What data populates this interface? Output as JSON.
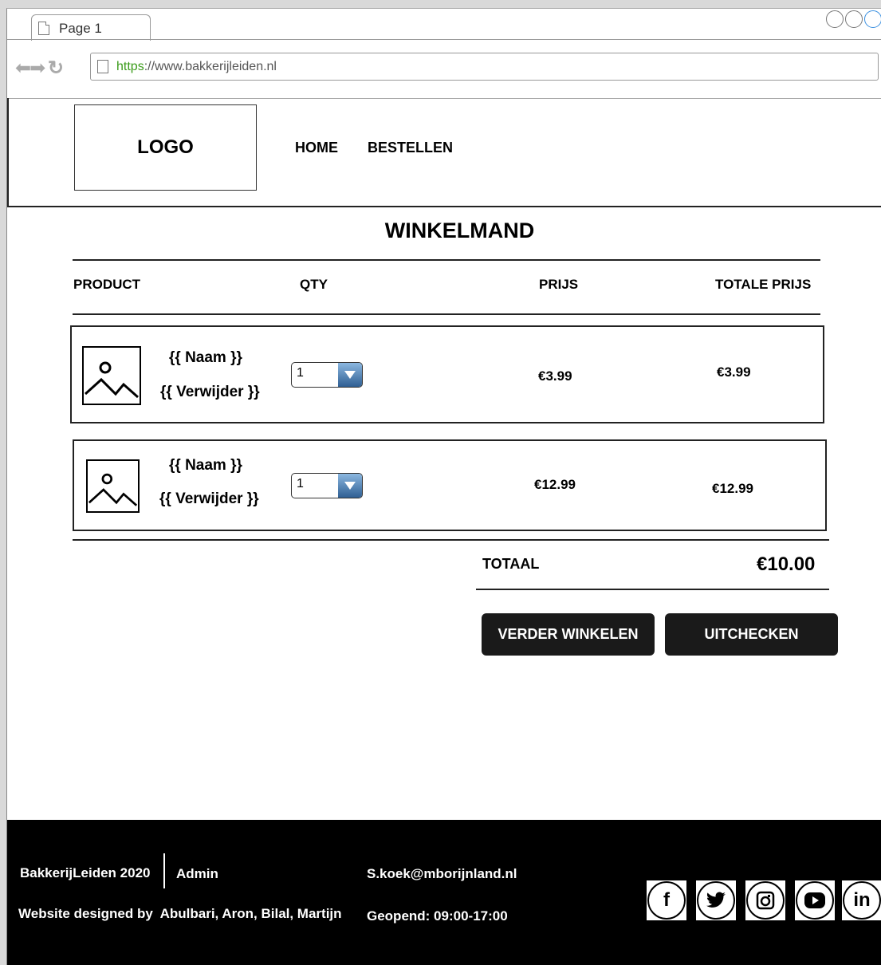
{
  "browser": {
    "tab_label": "Page 1",
    "url_scheme": "https",
    "url_rest": "://www.bakkerijleiden.nl"
  },
  "header": {
    "logo": "LOGO",
    "nav": [
      "HOME",
      "BESTELLEN"
    ]
  },
  "cart": {
    "title": "WINKELMAND",
    "columns": [
      "PRODUCT",
      "QTY",
      "PRIJS",
      "TOTALE PRIJS"
    ],
    "items": [
      {
        "name": "{{ Naam }}",
        "remove": "{{ Verwijder }}",
        "qty": "1",
        "price": "€3.99",
        "total": "€3.99"
      },
      {
        "name": "{{ Naam }}",
        "remove": "{{ Verwijder }}",
        "qty": "1",
        "price": "€12.99",
        "total": "€12.99"
      }
    ],
    "total_label": "TOTAAL",
    "total_value": "€10.00",
    "continue_label": "VERDER WINKELEN",
    "checkout_label": "UITCHECKEN"
  },
  "footer": {
    "copyright": "BakkerijLeiden 2020",
    "admin": "Admin",
    "email": "S.koek@mborijnland.nl",
    "designed_by": "Website designed by  Abulbari, Aron, Bilal, Martijn",
    "hours": "Geopend: 09:00-17:00",
    "social": [
      "facebook-icon",
      "twitter-icon",
      "instagram-icon",
      "youtube-icon",
      "linkedin-icon"
    ]
  }
}
